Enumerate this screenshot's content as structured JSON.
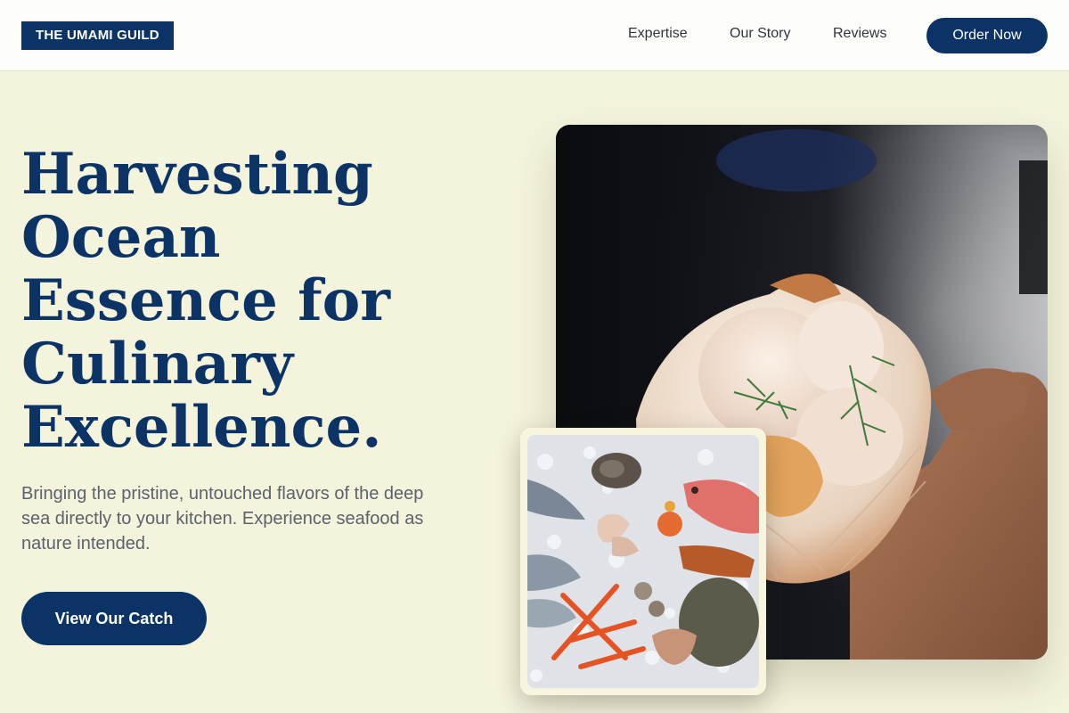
{
  "brand": {
    "logo_text": "THE UMAMI GUILD"
  },
  "nav": {
    "links": [
      "Expertise",
      "Our Story",
      "Reviews"
    ],
    "order_button": "Order Now"
  },
  "hero": {
    "headline_lines": [
      "Harvesting",
      "Ocean",
      "Essence for",
      "Culinary",
      "Excellence."
    ],
    "subtext": "Bringing the pristine, untouched flavors of the deep sea directly to your kitchen. Experience seafood as nature intended.",
    "cta_label": "View Our Catch"
  },
  "images": {
    "main": "scallop-in-hand-photo",
    "inset": "seafood-on-ice-photo"
  },
  "colors": {
    "brand_navy": "#0b3366",
    "background": "#f4f3dc",
    "topbar": "#fdfdf9",
    "body_text": "#5d616b"
  }
}
